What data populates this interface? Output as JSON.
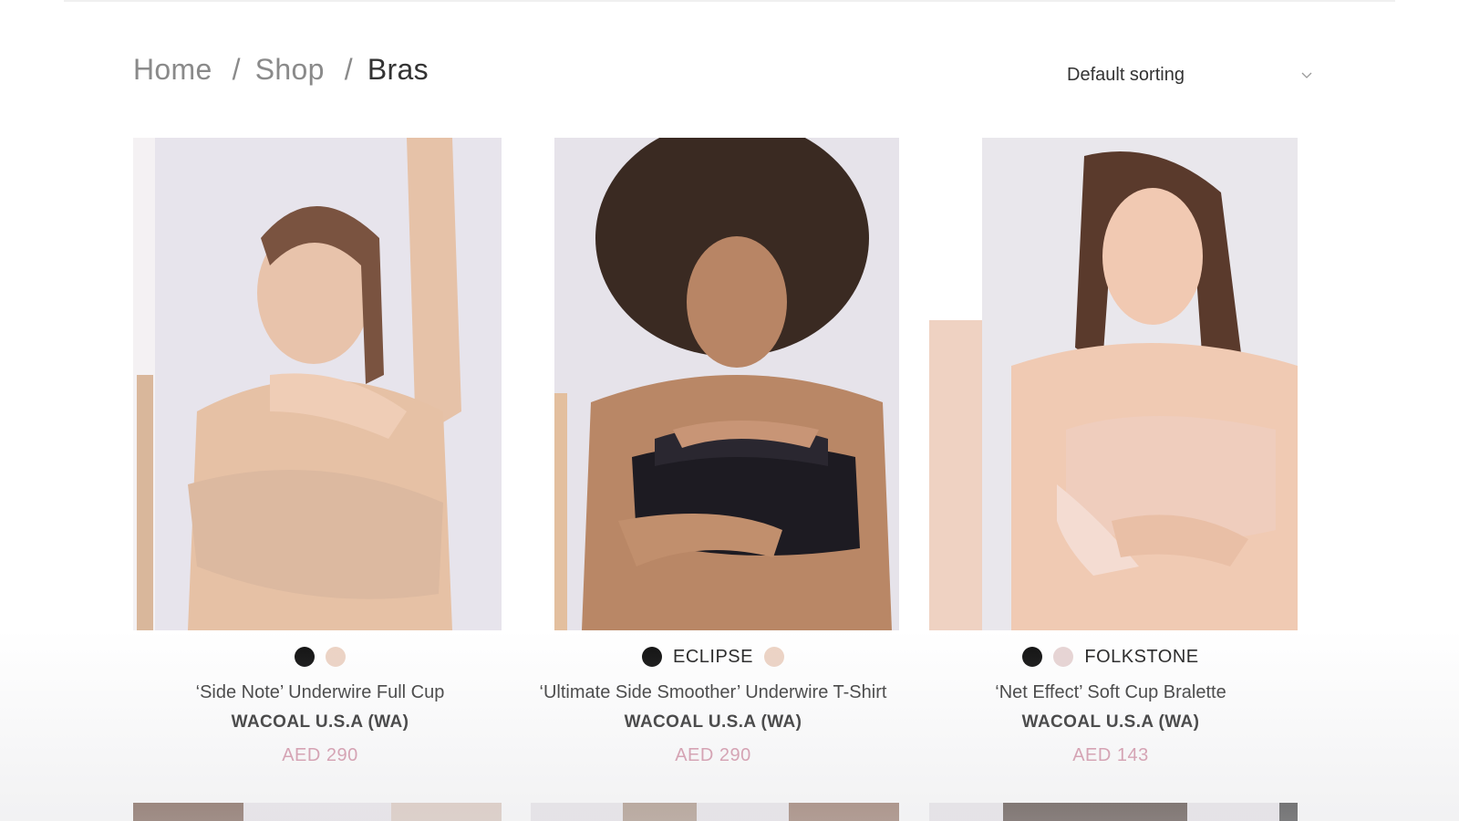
{
  "breadcrumb": {
    "home": "Home",
    "separator": "/",
    "shop": "Shop",
    "current": "Bras"
  },
  "sorting": {
    "selected": "Default sorting",
    "icon": "chevron-down-icon"
  },
  "colors": {
    "price": "#d08aa0",
    "swatch_black": "#0d0d0d",
    "swatch_nude": "#ecd2c3",
    "swatch_pink": "#e6d3d3"
  },
  "products": [
    {
      "swatch_label": "",
      "name": "‘Side Note’ Underwire Full Cup",
      "brand": "WACOAL U.S.A (WA)",
      "price": "AED 290"
    },
    {
      "swatch_label": "ECLIPSE",
      "name": "‘Ultimate Side Smoother’ Underwire T-Shirt",
      "brand": "WACOAL U.S.A (WA)",
      "price": "AED 290"
    },
    {
      "swatch_label": "FOLKSTONE",
      "name": "‘Net Effect’ Soft Cup Bralette",
      "brand": "WACOAL U.S.A (WA)",
      "price": "AED 143"
    }
  ]
}
